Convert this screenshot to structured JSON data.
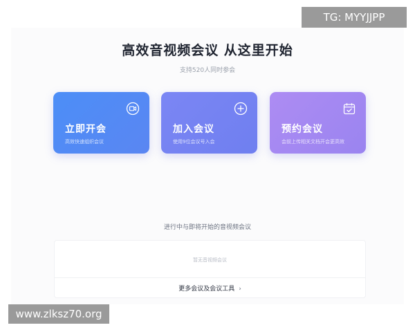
{
  "header": {
    "title": "高效音视频会议 从这里开始",
    "subtitle": "支持520人同时参会"
  },
  "cards": [
    {
      "title": "立即开会",
      "desc": "高效快速组织会议",
      "icon": "video-camera-icon",
      "color": "#4c8ef7"
    },
    {
      "title": "加入会议",
      "desc": "使用9位会议号入会",
      "icon": "plus-circle-icon",
      "color": "#737ff1"
    },
    {
      "title": "预约会议",
      "desc": "会前上传相关文档开会更高效",
      "icon": "calendar-check-icon",
      "color": "#a48af2"
    }
  ],
  "meetings": {
    "section_label": "进行中与即将开始的音视频会议",
    "empty_text": "暂无音视频会议",
    "more_label": "更多会议及会议工具",
    "more_chevron": "›"
  },
  "watermarks": {
    "tg": "TG: MYYJJPP",
    "site": "www.zlksz70.org"
  }
}
